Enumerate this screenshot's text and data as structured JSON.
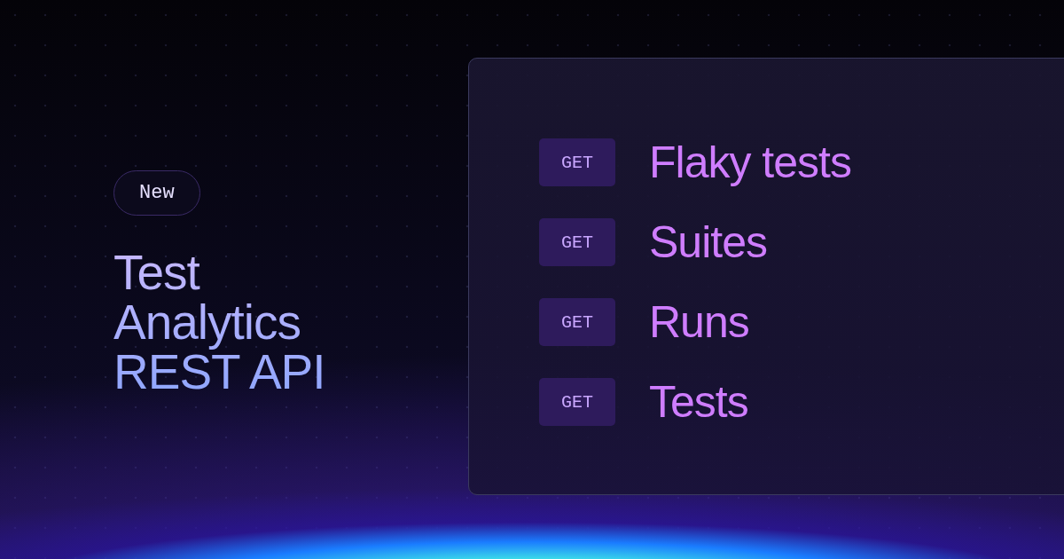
{
  "badge": "New",
  "headline": "Test Analytics REST API",
  "endpoints": [
    {
      "method": "GET",
      "name": "Flaky tests"
    },
    {
      "method": "GET",
      "name": "Suites"
    },
    {
      "method": "GET",
      "name": "Runs"
    },
    {
      "method": "GET",
      "name": "Tests"
    }
  ]
}
